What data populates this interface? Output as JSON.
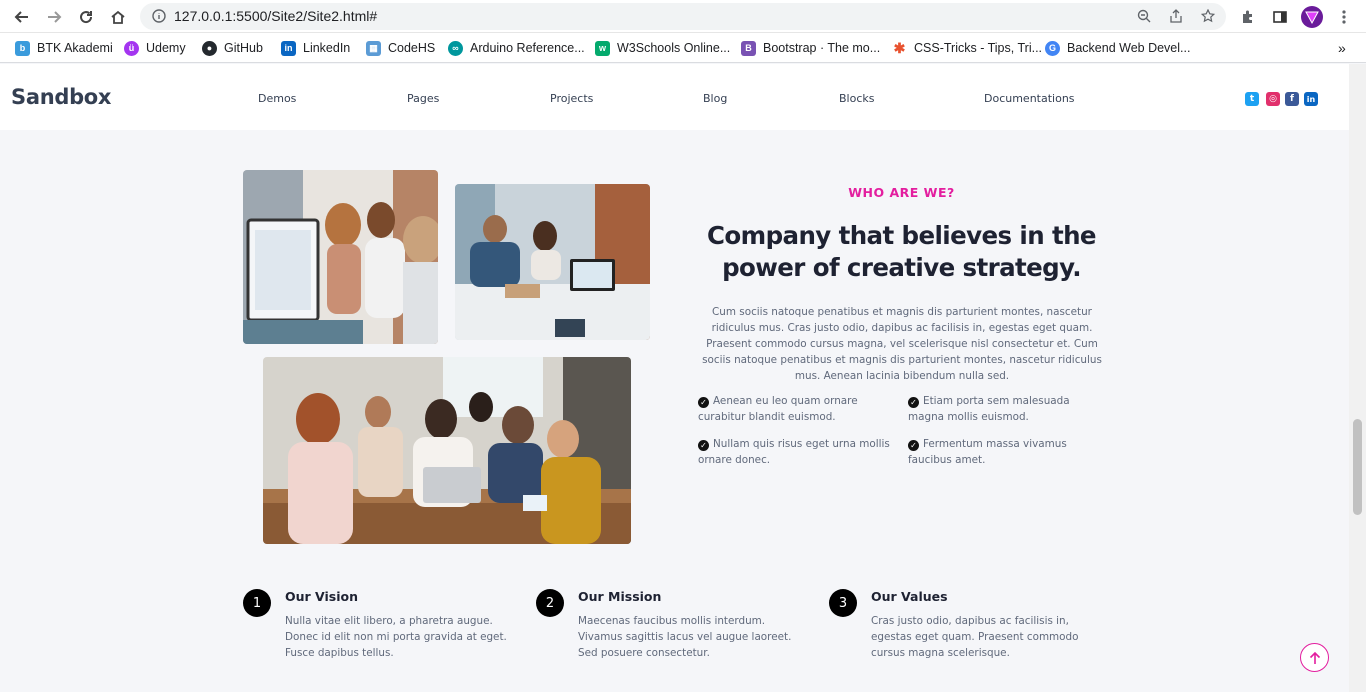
{
  "browser": {
    "url": "127.0.0.1:5500/Site2/Site2.html#",
    "bookmarks": [
      {
        "label": "BTK Akademi",
        "color": "#3a9bdc"
      },
      {
        "label": "Udemy",
        "color": "#a435f0"
      },
      {
        "label": "GitHub",
        "color": "#24292e"
      },
      {
        "label": "LinkedIn",
        "color": "#0a66c2"
      },
      {
        "label": "CodeHS",
        "color": "#5b9bd5"
      },
      {
        "label": "Arduino Reference...",
        "color": "#00979d"
      },
      {
        "label": "W3Schools Online...",
        "color": "#04aa6d"
      },
      {
        "label": "Bootstrap · The mo...",
        "color": "#7952b3"
      },
      {
        "label": "CSS-Tricks - Tips, Tri...",
        "color": "#e8522f"
      },
      {
        "label": "Backend Web Devel...",
        "color": "#4285f4"
      }
    ],
    "more_bookmarks": "»"
  },
  "site": {
    "logo": "Sandbox",
    "nav": [
      "Demos",
      "Pages",
      "Projects",
      "Blog",
      "Blocks",
      "Documentations"
    ],
    "social": [
      {
        "icon": "twitter-icon",
        "glyph": "t",
        "color": "#1da1f2"
      },
      {
        "icon": "instagram-icon",
        "glyph": "◎",
        "color": "#e1306c"
      },
      {
        "icon": "facebook-icon",
        "glyph": "f",
        "color": "#3b5998"
      },
      {
        "icon": "linkedin-icon",
        "glyph": "in",
        "color": "#0a66c2"
      }
    ]
  },
  "about": {
    "eyebrow": "WHO ARE WE?",
    "headline_line1": "Company that believes in the",
    "headline_line2": "power of creative strategy.",
    "lead": "Cum sociis natoque penatibus et magnis dis parturient montes, nascetur ridiculus mus. Cras justo odio, dapibus ac facilisis in, egestas eget quam. Praesent commodo cursus magna, vel scelerisque nisl consectetur et. Cum sociis natoque penatibus et magnis dis parturient montes, nascetur ridiculus mus. Aenean lacinia bibendum nulla sed.",
    "checks": [
      "Aenean eu leo quam ornare curabitur blandit euismod.",
      "Etiam porta sem malesuada magna mollis euismod.",
      "Nullam quis risus eget urna mollis ornare donec.",
      "Fermentum massa vivamus faucibus amet."
    ]
  },
  "features": [
    {
      "num": "1",
      "title": "Our Vision",
      "text": "Nulla vitae elit libero, a pharetra augue. Donec id elit non mi porta gravida at eget. Fusce dapibus tellus."
    },
    {
      "num": "2",
      "title": "Our Mission",
      "text": "Maecenas faucibus mollis interdum. Vivamus sagittis lacus vel augue laoreet. Sed posuere consectetur."
    },
    {
      "num": "3",
      "title": "Our Values",
      "text": "Cras justo odio, dapibus ac facilisis in, egestas eget quam. Praesent commodo cursus magna scelerisque."
    }
  ],
  "colors": {
    "accent": "#e31e9f",
    "heading": "#1e2232",
    "body": "#60697b"
  }
}
